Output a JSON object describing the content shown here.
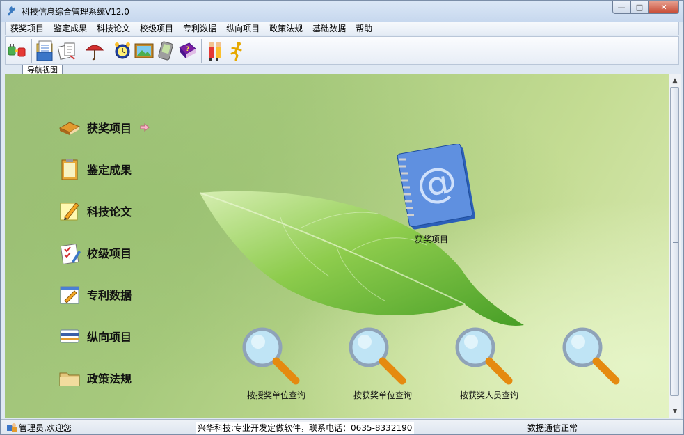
{
  "window": {
    "title": "科技信息综合管理系统V12.0"
  },
  "menu": [
    "获奖项目",
    "鉴定成果",
    "科技论文",
    "校级项目",
    "专利数据",
    "纵向项目",
    "政策法规",
    "基础数据",
    "帮助"
  ],
  "toolbar": {
    "icons": [
      "plug-icon",
      "folder-scroll-icon",
      "documents-icon",
      "umbrella-icon",
      "alarm-clock-icon",
      "picture-icon",
      "pda-icon",
      "help-book-icon",
      "people-icon",
      "runner-icon"
    ]
  },
  "tab": {
    "label": "导航视图"
  },
  "nav": [
    {
      "label": "获奖项目",
      "icon": "book-icon",
      "selected": true
    },
    {
      "label": "鉴定成果",
      "icon": "clipboard-icon"
    },
    {
      "label": "科技论文",
      "icon": "pencil-note-icon"
    },
    {
      "label": "校级项目",
      "icon": "checklist-icon"
    },
    {
      "label": "专利数据",
      "icon": "edit-window-icon"
    },
    {
      "label": "纵向项目",
      "icon": "card-icon"
    },
    {
      "label": "政策法规",
      "icon": "folder-icon"
    }
  ],
  "feature": {
    "label": "获奖项目",
    "icon": "address-book-icon"
  },
  "queries": [
    {
      "label": "按授奖单位查询"
    },
    {
      "label": "按获奖单位查询"
    },
    {
      "label": "按获奖人员查询"
    },
    {
      "label": ""
    }
  ],
  "status": {
    "user": "管理员,欢迎您",
    "company": "兴华科技:专业开发定做软件，联系电话：0635-8332190",
    "connection": "数据通信正常"
  },
  "colors": {
    "accent": "#4a7fd4",
    "content_green": "#a6c97c",
    "leaf_green": "#5aa62c"
  }
}
